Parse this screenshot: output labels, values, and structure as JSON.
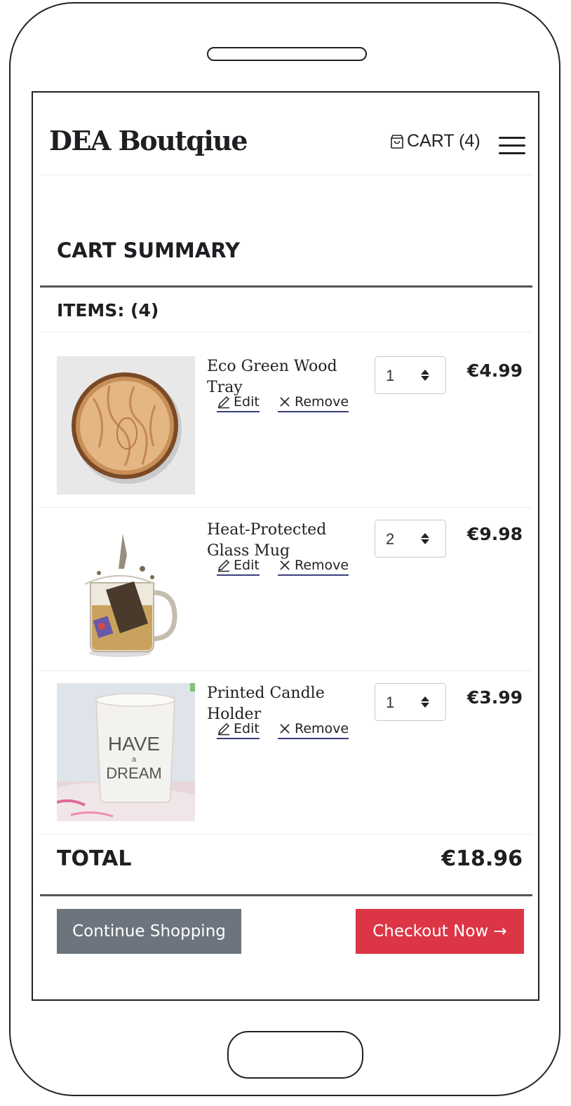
{
  "brand": "DEA Boutqiue",
  "header": {
    "cart_label": "CART (4)"
  },
  "summary": {
    "title": "CART SUMMARY",
    "items_count": "ITEMS: (4)"
  },
  "items": [
    {
      "name": "Eco Green Wood Tray",
      "qty": "1",
      "price": "€4.99",
      "edit": "Edit",
      "remove": "Remove"
    },
    {
      "name": "Heat-Protected Glass Mug",
      "qty": "2",
      "price": "€9.98",
      "edit": "Edit",
      "remove": "Remove"
    },
    {
      "name": "Printed Candle Holder",
      "qty": "1",
      "price": "€3.99",
      "edit": "Edit",
      "remove": "Remove"
    }
  ],
  "candle_print": {
    "line1": "HAVE",
    "line2": "a",
    "line3": "DREAM"
  },
  "total": {
    "label": "TOTAL",
    "value": "€18.96"
  },
  "buttons": {
    "continue": "Continue Shopping",
    "checkout": "Checkout Now →"
  },
  "colors": {
    "checkout": "#dc3545",
    "continue": "#6c757d",
    "link_underline": "#3a3f7a"
  },
  "icons": {
    "cart": "shopping-bag-icon",
    "menu": "hamburger-icon",
    "edit": "pencil-icon",
    "remove": "x-icon",
    "qty": "sort-arrows-icon"
  }
}
